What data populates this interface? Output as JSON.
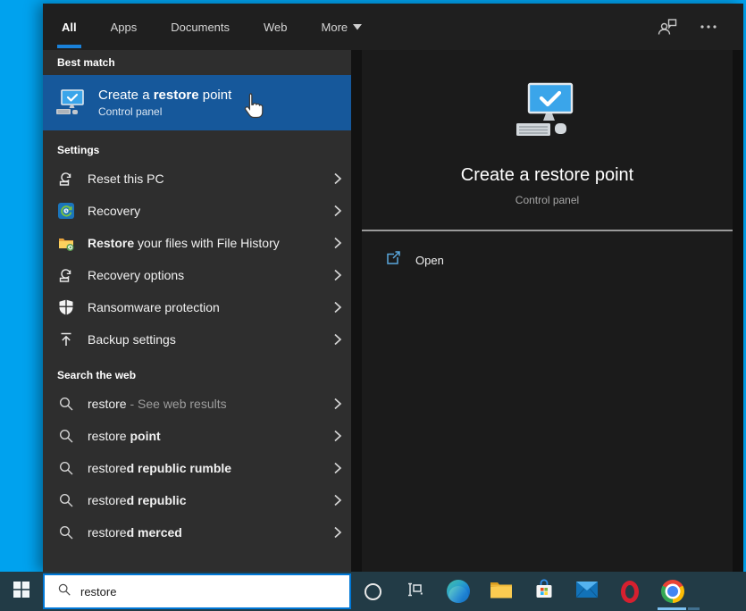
{
  "tabs": {
    "items": [
      {
        "label": "All",
        "active": true
      },
      {
        "label": "Apps",
        "active": false
      },
      {
        "label": "Documents",
        "active": false
      },
      {
        "label": "Web",
        "active": false
      },
      {
        "label": "More",
        "active": false,
        "has_dropdown": true
      }
    ]
  },
  "best_match": {
    "section_label": "Best match",
    "title_prefix": "Create a ",
    "title_bold": "restore",
    "title_suffix": " point",
    "subtitle": "Control panel",
    "icon": "system-restore-monitor-icon",
    "highlight_color": "#16589b"
  },
  "settings": {
    "section_label": "Settings",
    "items": [
      {
        "prefix": "Reset this PC",
        "bold": "",
        "suffix": "",
        "icon": "reset-pc-icon"
      },
      {
        "prefix": "Recovery",
        "bold": "",
        "suffix": "",
        "icon": "recovery-control-panel-icon"
      },
      {
        "prefix": "",
        "bold": "Restore",
        "suffix": " your files with File History",
        "icon": "file-history-folder-icon"
      },
      {
        "prefix": "Recovery options",
        "bold": "",
        "suffix": "",
        "icon": "reset-pc-icon"
      },
      {
        "prefix": "Ransomware protection",
        "bold": "",
        "suffix": "",
        "icon": "defender-shield-icon"
      },
      {
        "prefix": "Backup settings",
        "bold": "",
        "suffix": "",
        "icon": "backup-upload-icon"
      }
    ]
  },
  "web": {
    "section_label": "Search the web",
    "items": [
      {
        "prefix": "restore",
        "bold": "",
        "dim": " - See web results",
        "icon": "search-icon"
      },
      {
        "prefix": "restore ",
        "bold": "point",
        "dim": "",
        "icon": "search-icon"
      },
      {
        "prefix": "restore",
        "bold": "d republic rumble",
        "dim": "",
        "icon": "search-icon"
      },
      {
        "prefix": "restore",
        "bold": "d republic",
        "dim": "",
        "icon": "search-icon"
      },
      {
        "prefix": "restore",
        "bold": "d merced",
        "dim": "",
        "icon": "search-icon"
      }
    ]
  },
  "preview": {
    "title": "Create a restore point",
    "subtitle": "Control panel",
    "icon": "system-restore-monitor-icon",
    "actions": [
      {
        "label": "Open",
        "icon": "open-external-icon"
      }
    ]
  },
  "taskbar": {
    "search_value": "restore",
    "icons": [
      "cortana",
      "task-view",
      "edge",
      "file-explorer",
      "microsoft-store",
      "mail",
      "opera",
      "chrome"
    ],
    "active_app": "chrome"
  },
  "colors": {
    "accent": "#0078d7",
    "desktop_background": "#00a2ee",
    "taskbar_background": "#223b46",
    "best_match_highlight": "#16589b",
    "tab_underline": "#1a81d9"
  }
}
